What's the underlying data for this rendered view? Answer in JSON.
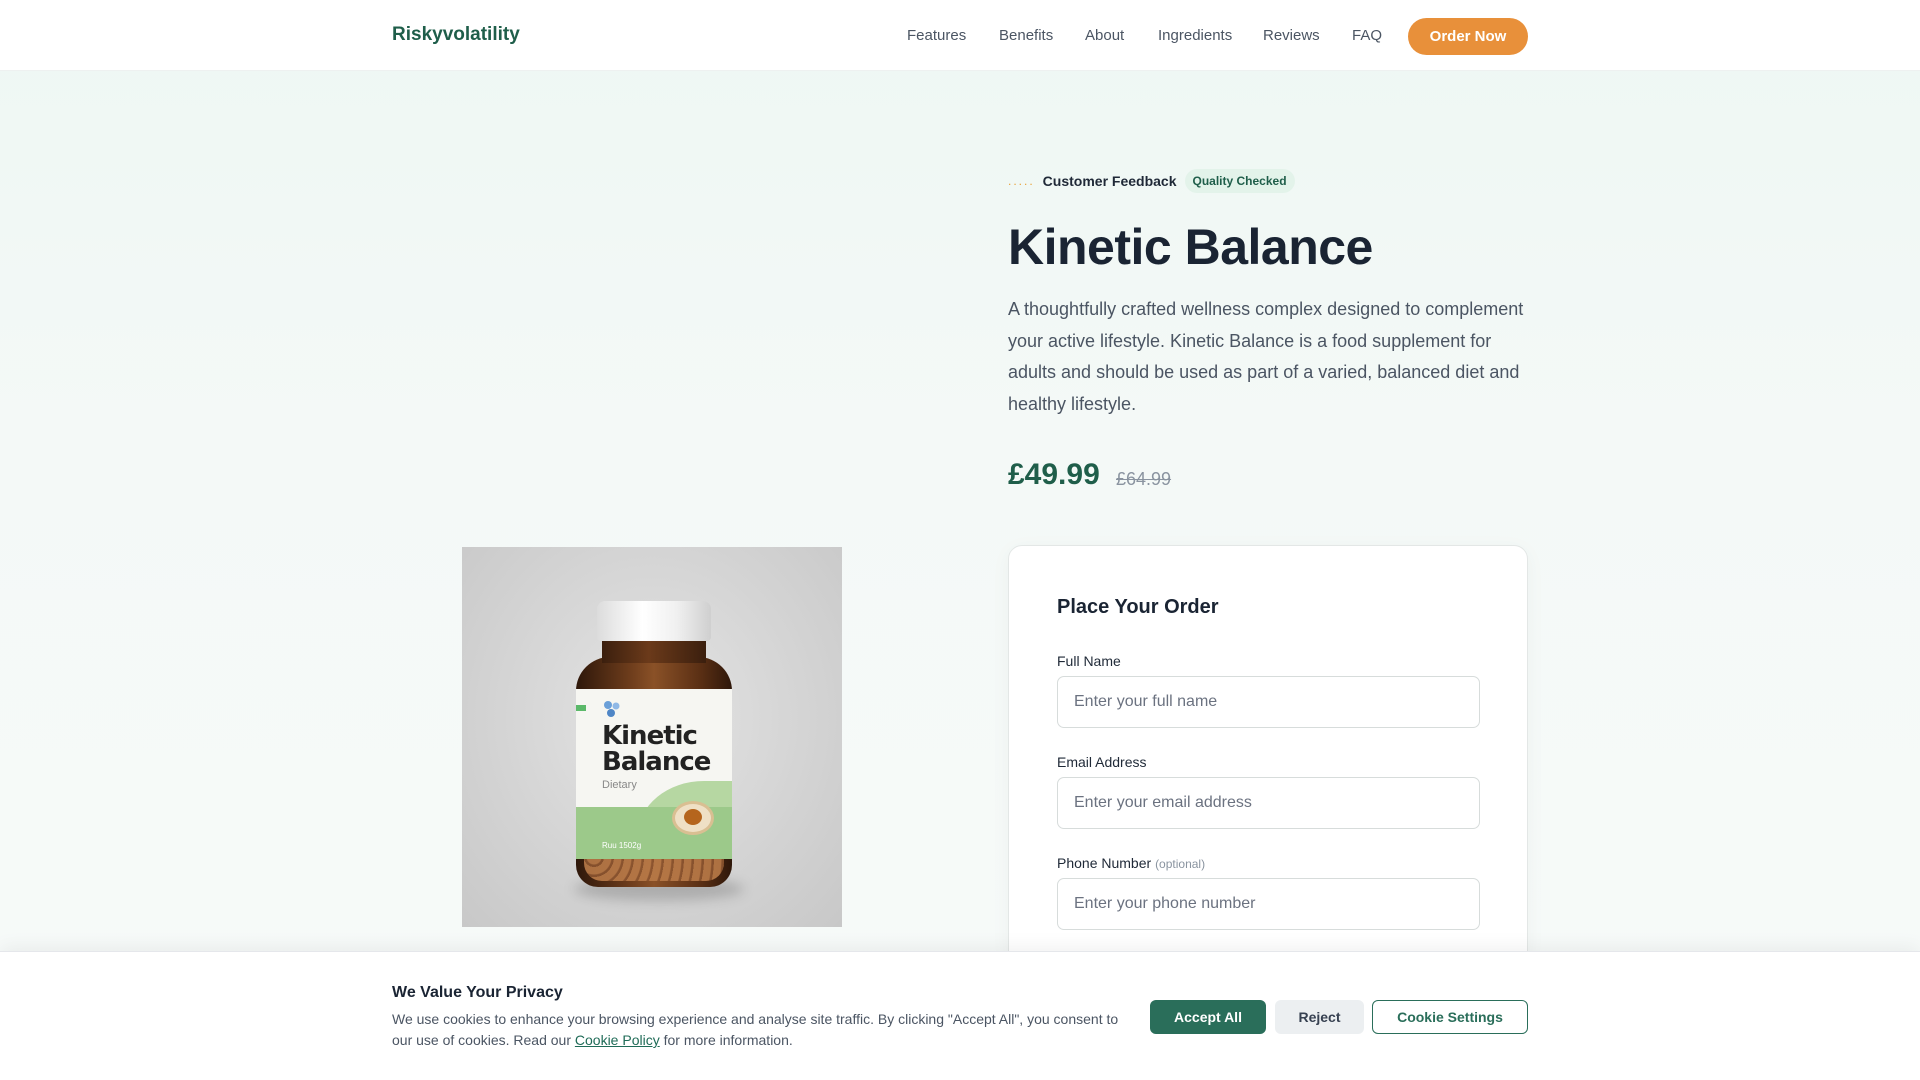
{
  "header": {
    "brand": "Riskyvolatility",
    "nav": [
      "Features",
      "Benefits",
      "About",
      "Ingredients",
      "Reviews",
      "FAQ"
    ],
    "cta": "Order Now"
  },
  "product_image": {
    "label_title_line1": "Kinetic",
    "label_title_line2": "Balance",
    "label_subtitle": "Dietary",
    "label_net": "Ruu 1502g"
  },
  "hero": {
    "stars": ".....",
    "feedback_label": "Customer Feedback",
    "quality_badge": "Quality Checked",
    "title": "Kinetic Balance",
    "description": "A thoughtfully crafted wellness complex designed to complement your active lifestyle. Kinetic Balance is a food supplement for adults and should be used as part of a varied, balanced diet and healthy lifestyle.",
    "price": "£49.99",
    "old_price": "£64.99"
  },
  "order_form": {
    "title": "Place Your Order",
    "full_name": {
      "label": "Full Name",
      "placeholder": "Enter your full name"
    },
    "email": {
      "label": "Email Address",
      "placeholder": "Enter your email address"
    },
    "phone": {
      "label": "Phone Number",
      "optional": "(optional)",
      "placeholder": "Enter your phone number"
    }
  },
  "cookie_banner": {
    "title": "We Value Your Privacy",
    "text_before": "We use cookies to enhance your browsing experience and analyse site traffic. By clicking \"Accept All\", you consent to our use of cookies. Read our ",
    "link": "Cookie Policy",
    "text_after": " for more information.",
    "accept": "Accept All",
    "reject": "Reject",
    "settings": "Cookie Settings"
  },
  "colors": {
    "brand_green": "#1f5e4a",
    "accent_orange": "#e8903a",
    "button_green": "#2a6e5a"
  }
}
